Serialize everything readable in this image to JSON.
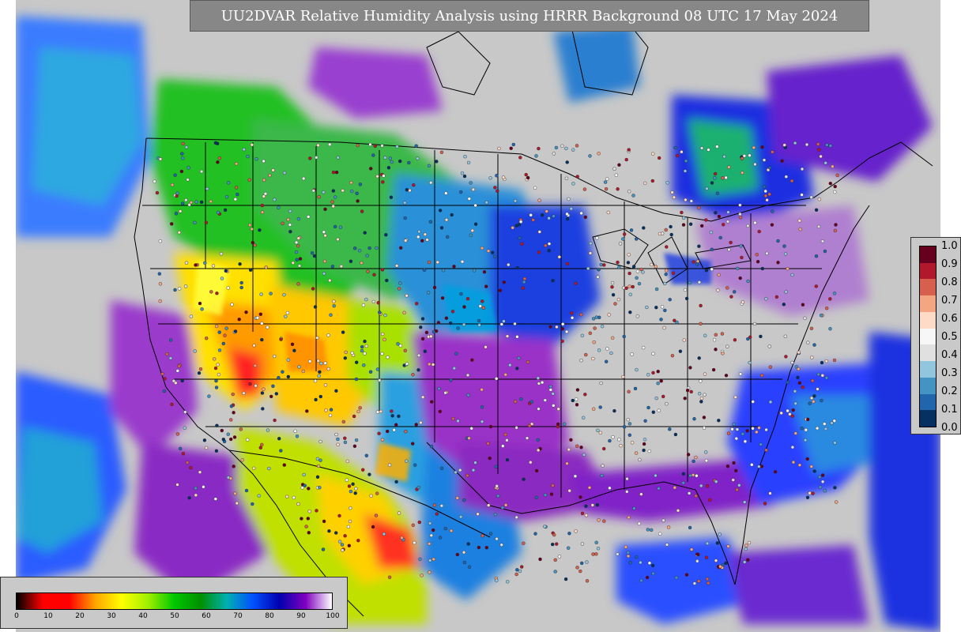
{
  "title": "UU2DVAR Relative Humidity Analysis using HRRR Background 08 UTC 17 May 2024",
  "observation_legend": {
    "ticks": [
      "1.0",
      "0.9",
      "0.8",
      "0.7",
      "0.6",
      "0.5",
      "0.4",
      "0.3",
      "0.2",
      "0.1",
      "0.0"
    ],
    "colors": [
      "#67001f",
      "#b2182b",
      "#d6604d",
      "#f4a582",
      "#fddbc7",
      "#f7f7f7",
      "#e0e0e0",
      "#92c5de",
      "#4393c3",
      "#2166ac",
      "#053061"
    ]
  },
  "rh_colorbar": {
    "ticks": [
      "0",
      "10",
      "20",
      "30",
      "40",
      "50",
      "60",
      "70",
      "80",
      "90",
      "100"
    ],
    "colors": [
      "#000000",
      "#ff0000",
      "#ff0000",
      "#ffa500",
      "#ffff00",
      "#a0f000",
      "#00c800",
      "#009000",
      "#00b0b0",
      "#0050ff",
      "#0000b0",
      "#8000c0",
      "#ffffff"
    ]
  },
  "map": {
    "background_color": "#c8c8c8",
    "border_color": "#000000"
  }
}
